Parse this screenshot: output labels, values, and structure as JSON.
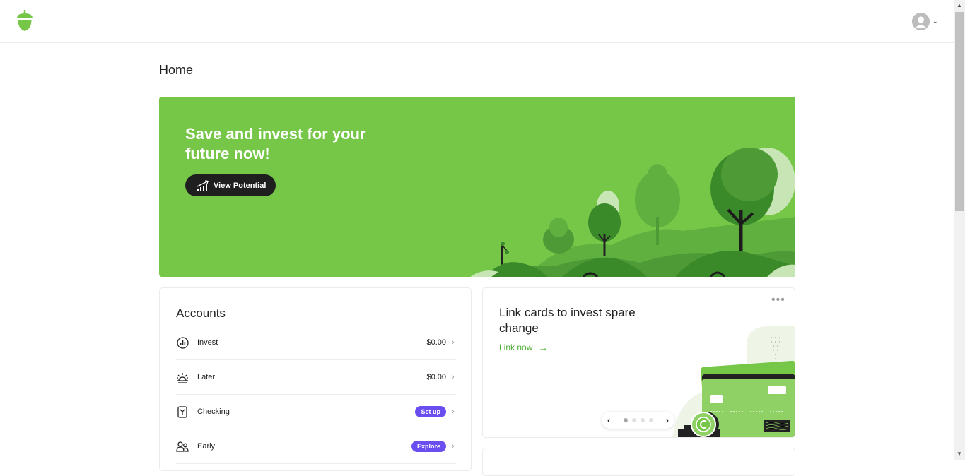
{
  "header": {
    "logo_icon": "acorn-logo-icon",
    "profile_icon": "user-avatar-icon",
    "profile_chevron": "⌄"
  },
  "page": {
    "title": "Home"
  },
  "hero": {
    "title": "Save and invest for your future now!",
    "button_label": "View Potential",
    "button_icon": "growth-chart-icon",
    "background_color": "#76c748"
  },
  "accounts": {
    "title": "Accounts",
    "rows": [
      {
        "label": "Invest",
        "value": "$0.00",
        "icon": "bar-chart-icon"
      },
      {
        "label": "Later",
        "value": "$0.00",
        "icon": "sunrise-icon"
      },
      {
        "label": "Checking",
        "badge": "Set up",
        "icon": "checking-card-icon"
      },
      {
        "label": "Early",
        "badge": "Explore",
        "icon": "family-icon"
      }
    ],
    "badge_color": "#6b4ef0"
  },
  "promo": {
    "title": "Link cards to invest spare change",
    "link_label": "Link now",
    "link_arrow": "→",
    "more_label": "•••",
    "carousel": {
      "prev": "‹",
      "next": "›",
      "count": 4,
      "active": 0
    }
  },
  "scrollbar": {
    "up": "▲",
    "down": "▼"
  }
}
